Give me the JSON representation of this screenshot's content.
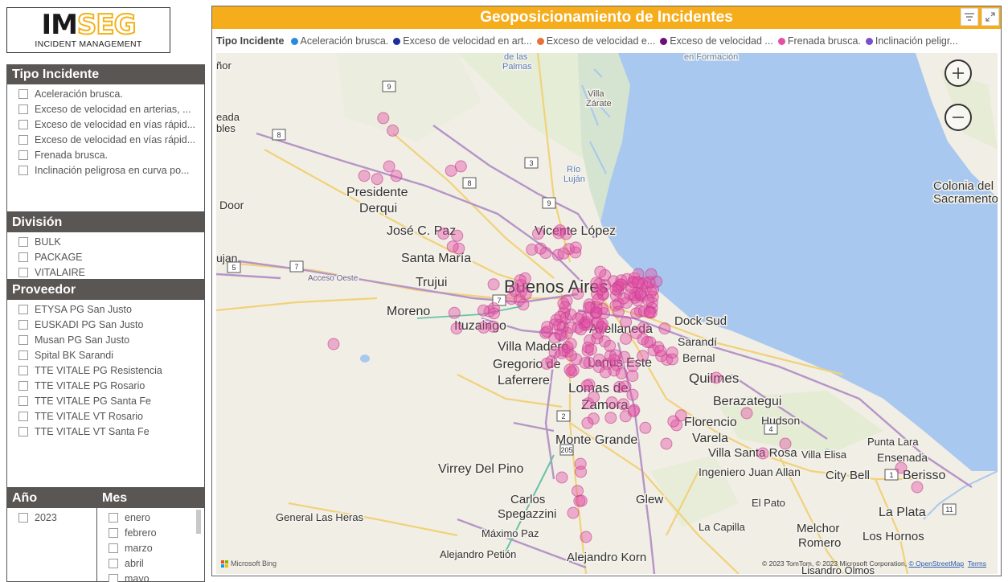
{
  "logo": {
    "im": "IM",
    "seg": "SEG",
    "sub": "INCIDENT MANAGEMENT"
  },
  "tipo_incidente": {
    "title": "Tipo Incidente",
    "options": [
      "Aceleración brusca.",
      "Exceso de velocidad en arterias, ...",
      "Exceso de velocidad en vías rápid...",
      "Exceso de velocidad en vías rápid...",
      "Frenada brusca.",
      "Inclinación peligrosa en curva po..."
    ]
  },
  "division": {
    "title": "División",
    "options": [
      "BULK",
      "PACKAGE",
      "VITALAIRE"
    ]
  },
  "proveedor": {
    "title": "Proveedor",
    "options": [
      "ETYSA PG San Justo",
      "EUSKADI PG San Justo",
      "Musan PG San Justo",
      "Spital BK Sarandi",
      "TTE VITALE PG Resistencia",
      "TTE VITALE PG Rosario",
      "TTE VITALE PG Santa Fe",
      "TTE VITALE VT Rosario",
      "TTE VITALE VT Santa Fe"
    ]
  },
  "anio": {
    "title": "Año",
    "options": [
      "2023"
    ]
  },
  "mes": {
    "title": "Mes",
    "options": [
      "enero",
      "febrero",
      "marzo",
      "abril",
      "mayo"
    ]
  },
  "visual": {
    "title": "Geoposicionamiento de Incidentes",
    "legend_title": "Tipo Incidente",
    "legend": [
      {
        "label": "Aceleración brusca.",
        "color": "#2b8ae0"
      },
      {
        "label": "Exceso de velocidad en art...",
        "color": "#1d2f9c"
      },
      {
        "label": "Exceso de velocidad e...",
        "color": "#e8713a"
      },
      {
        "label": "Exceso de velocidad ...",
        "color": "#6b0f7a"
      },
      {
        "label": "Frenada brusca.",
        "color": "#e24fa4"
      },
      {
        "label": "Inclinación peligr...",
        "color": "#7b4fc9"
      }
    ]
  },
  "map": {
    "labels": {
      "buenos_aires": "Buenos Aires",
      "presidente": "Presidente",
      "derqui": "Derqui",
      "jose_c_paz": "José C. Paz",
      "santa_maria": "Santa María",
      "trujui": "Trujui",
      "moreno": "Moreno",
      "ituzaingo": "Ituzaingo",
      "villa_madero": "Villa Madero",
      "gregorio": "Gregorio de",
      "laferrere": "Laferrere",
      "vicente_lopez": "Vicente López",
      "avellaneda": "Avellaneda",
      "dock_sud": "Dock Sud",
      "sarandi": "Sarandí",
      "bernal": "Bernal",
      "lanus_este": "Lanús Este",
      "lomas_de": "Lomas de",
      "zamora": "Zamora",
      "quilmes": "Quilmes",
      "berazategui": "Berazategui",
      "florencio": "Florencio",
      "varela": "Varela",
      "hudson": "Hudson",
      "monte_grande": "Monte Grande",
      "villa_santa_rosa": "Villa Santa Rosa",
      "villa_elisa": "Villa Elisa",
      "ingeniero": "Ingeniero Juan Allan",
      "city_bell": "City Bell",
      "berisso": "Berisso",
      "punta_lara": "Punta Lara",
      "ensenada": "Ensenada",
      "la_plata": "La Plata",
      "los_hornos": "Los Hornos",
      "virrey": "Virrey Del Pino",
      "carlos": "Carlos",
      "spegazzini": "Spegazzini",
      "maximo_paz": "Máximo Paz",
      "general_las_heras": "General Las Heras",
      "alejandro_petion": "Alejandro Petión",
      "alejandro_korn": "Alejandro Korn",
      "glew": "Glew",
      "el_pato": "El Pato",
      "la_capilla": "La Capilla",
      "melchor": "Melchor",
      "romero": "Romero",
      "colonia": "Colonia del",
      "sacramento": "Sacramento",
      "villa_zarate": "Villa",
      "zarate": "Zárate",
      "rio": "Río",
      "lujan_river": "Luján",
      "de_las_palmas_1": "de las",
      "de_las_palmas_2": "Palmas",
      "en_formacion": "en Formación",
      "acceso_oeste": "Acceso Oeste",
      "door": "Door",
      "ujan": "ujan",
      "eada": "eada",
      "bles": "bles",
      "for": "ñor",
      "lisandro": "Lisandro Olmos"
    },
    "road_shields": [
      "9",
      "8",
      "3",
      "8",
      "9",
      "7",
      "5",
      "7",
      "2",
      "205",
      "4",
      "1",
      "11"
    ],
    "copyright": "© 2023 TomTom, © 2023 Microsoft Corporation,",
    "osm": "© OpenStreetMap",
    "terms": "Terms",
    "bing": "Microsoft Bing",
    "point_color": "#e24fa4"
  }
}
